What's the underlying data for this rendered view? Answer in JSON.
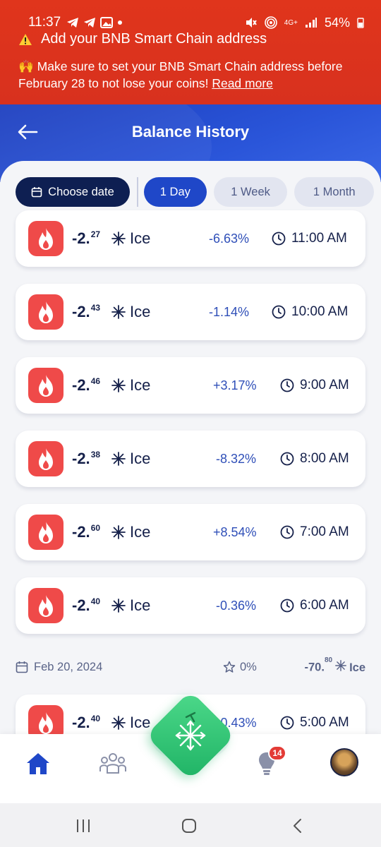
{
  "status_bar": {
    "time": "11:37",
    "battery": "54%",
    "network": "4G+"
  },
  "banner": {
    "title": "Add your BNB Smart Chain address",
    "message": "🙌 Make sure to set your BNB Smart Chain address before February 28 to not lose your coins!",
    "link": "Read more"
  },
  "header": {
    "title": "Balance History"
  },
  "filters": {
    "choose_date": "Choose date",
    "chips": [
      "1 Day",
      "1 Week",
      "1 Month"
    ],
    "active": "1 Day"
  },
  "unit": "Ice",
  "entries": [
    {
      "whole": "-2.",
      "frac": "27",
      "change": "-6.63%",
      "time": "11:00 AM"
    },
    {
      "whole": "-2.",
      "frac": "43",
      "change": "-1.14%",
      "time": "10:00 AM"
    },
    {
      "whole": "-2.",
      "frac": "46",
      "change": "+3.17%",
      "time": "9:00 AM"
    },
    {
      "whole": "-2.",
      "frac": "38",
      "change": "-8.32%",
      "time": "8:00 AM"
    },
    {
      "whole": "-2.",
      "frac": "60",
      "change": "+8.54%",
      "time": "7:00 AM"
    },
    {
      "whole": "-2.",
      "frac": "40",
      "change": "-0.36%",
      "time": "6:00 AM"
    }
  ],
  "day_summary": {
    "date": "Feb 20, 2024",
    "percent": "0%",
    "total_whole": "-70.",
    "total_frac": "80",
    "unit": "Ice"
  },
  "next_entry": {
    "whole": "-2.",
    "frac": "40",
    "change": "+0.43%",
    "time": "5:00 AM"
  },
  "bottom_nav": {
    "notifications_badge": "14"
  },
  "icons": {
    "banner": "warning-icon",
    "fire": "fire-icon",
    "ice": "ice-snowflake-icon",
    "clock": "clock-icon",
    "calendar": "calendar-icon",
    "star": "star-icon",
    "home": "home-icon",
    "team": "team-icon",
    "mining": "mining-icon",
    "bulb": "bulb-icon"
  },
  "colors": {
    "banner": "#dc331d",
    "header": "#2548c9",
    "fire": "#ef4a49",
    "chip_active": "#1f47c8",
    "choose_date": "#0e1f52",
    "mining": "#2ec873"
  }
}
